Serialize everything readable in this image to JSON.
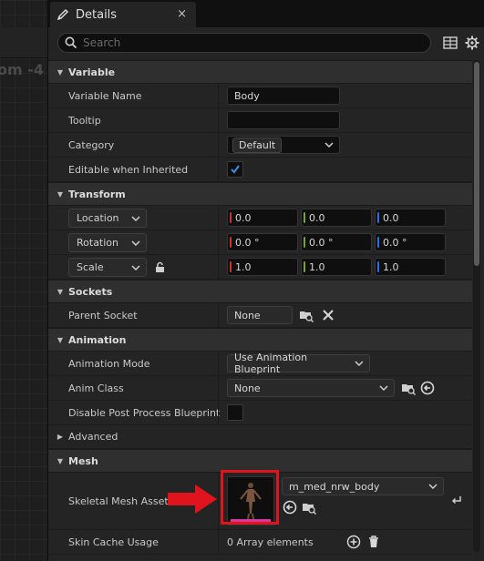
{
  "graph": {
    "zoom_text": "om -4"
  },
  "tab": {
    "title": "Details",
    "close": "×"
  },
  "search": {
    "placeholder": "Search"
  },
  "sections": {
    "variable": "Variable",
    "transform": "Transform",
    "sockets": "Sockets",
    "animation": "Animation",
    "advanced": "Advanced",
    "mesh": "Mesh"
  },
  "variable": {
    "name_label": "Variable Name",
    "name_value": "Body",
    "tooltip_label": "Tooltip",
    "tooltip_value": "",
    "category_label": "Category",
    "category_value": "Default",
    "editable_label": "Editable when Inherited",
    "editable_checked": true
  },
  "transform": {
    "location": {
      "label": "Location",
      "x": "0.0",
      "y": "0.0",
      "z": "0.0"
    },
    "rotation": {
      "label": "Rotation",
      "x": "0.0 °",
      "y": "0.0 °",
      "z": "0.0 °"
    },
    "scale": {
      "label": "Scale",
      "x": "1.0",
      "y": "1.0",
      "z": "1.0"
    }
  },
  "sockets": {
    "parent_label": "Parent Socket",
    "parent_value": "None"
  },
  "animation": {
    "mode_label": "Animation Mode",
    "mode_value": "Use Animation Blueprint",
    "class_label": "Anim Class",
    "class_value": "None",
    "disable_pp_label": "Disable Post Process Blueprint",
    "disable_pp_checked": false
  },
  "mesh": {
    "asset_label": "Skeletal Mesh Asset",
    "asset_value": "m_med_nrw_body",
    "skin_cache_label": "Skin Cache Usage",
    "skin_cache_value": "0 Array elements"
  },
  "colors": {
    "axis_x": "#c8372d",
    "axis_y": "#6fa82f",
    "axis_z": "#2f6fd6",
    "highlight": "#e0141c",
    "check": "#3d8ee8"
  },
  "icons": [
    "pencil-icon",
    "close-icon",
    "search-icon",
    "table-icon",
    "gear-icon",
    "chevron-down-icon",
    "lock-icon",
    "browse-icon",
    "clear-icon",
    "use-selected-icon",
    "add-icon",
    "trash-icon",
    "reset-icon",
    "arrow-icon"
  ]
}
